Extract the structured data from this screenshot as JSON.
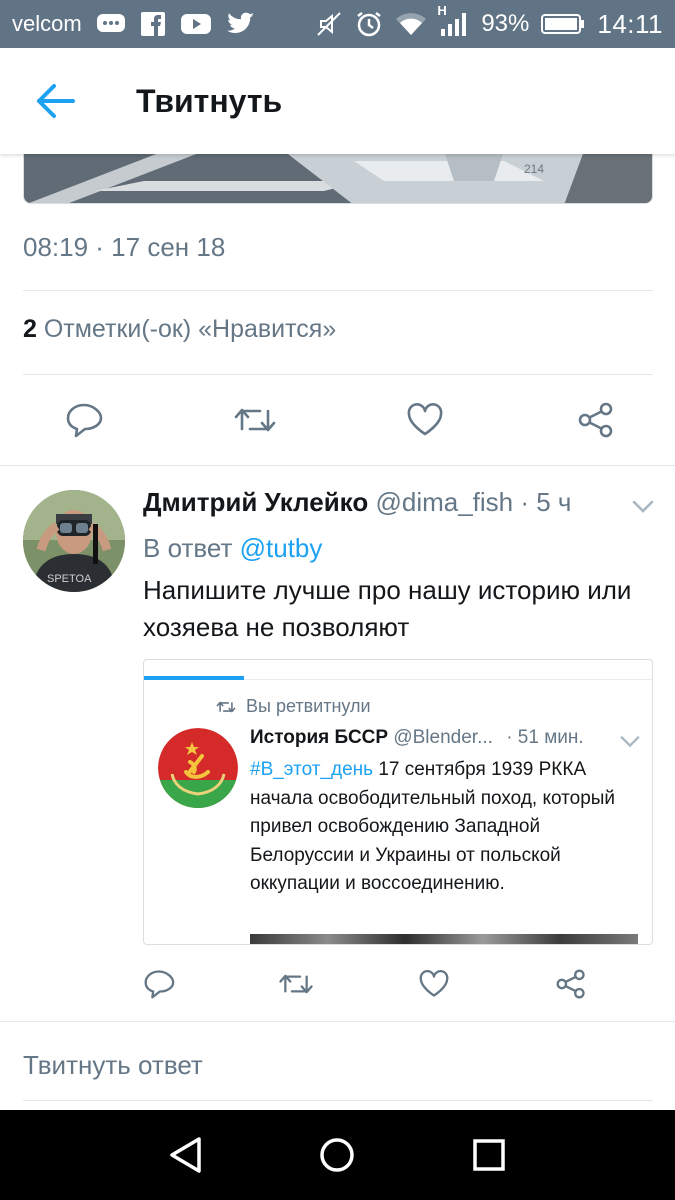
{
  "status_bar": {
    "carrier": "velcom",
    "battery_percent": "93%",
    "time": "14:11",
    "network_type": "H",
    "icons": [
      "chat-icon",
      "facebook-icon",
      "youtube-icon",
      "twitter-icon",
      "mute-icon",
      "alarm-icon",
      "wifi-icon",
      "signal-icon",
      "battery-icon"
    ]
  },
  "header": {
    "title": "Твитнуть",
    "back_icon": "arrow-left-icon"
  },
  "main_tweet": {
    "timestamp": "08:19 · 17 сен 18",
    "likes_count": "2",
    "likes_label": " Отметки(-ок) «Нравится»",
    "actions": [
      "reply-icon",
      "retweet-icon",
      "like-icon",
      "share-icon"
    ]
  },
  "reply": {
    "name": "Дмитрий Уклейко",
    "handle": "@dima_fish",
    "time": " · 5 ч",
    "reply_prefix": "В ответ ",
    "reply_mention": "@tutby",
    "text": "Напишите лучше про нашу историю или хозяева не позволяют",
    "actions": [
      "reply-icon",
      "retweet-icon",
      "like-icon",
      "share-icon"
    ]
  },
  "quoted": {
    "retweeted_label": "Вы ретвитнули",
    "name": "История БССР",
    "handle": "@Blender...",
    "time": "· 51 мин.",
    "hashtag": "#В_этот_день",
    "text": " 17 сентября 1939 РККА начала освободительный поход, который привел освобождению Западной Белоруссии и Украины от польской оккупации и воссоединению."
  },
  "compose": {
    "placeholder": "Твитнуть ответ"
  },
  "colors": {
    "accent": "#1da1f2",
    "muted": "#657786",
    "statusbar": "#607486",
    "divider": "#e1e8ed"
  }
}
